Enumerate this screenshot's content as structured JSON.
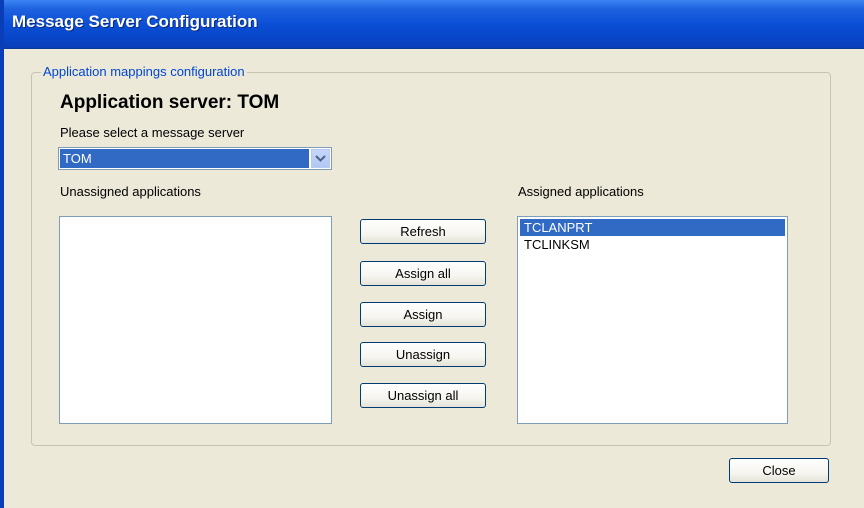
{
  "window": {
    "title": "Message Server Configuration"
  },
  "group": {
    "legend": "Application mappings configuration",
    "heading": "Application server: TOM",
    "select_label": "Please select a message server",
    "server_select": {
      "value": "TOM"
    }
  },
  "unassigned": {
    "label": "Unassigned applications",
    "items": []
  },
  "assigned": {
    "label": "Assigned applications",
    "items": [
      "TCLANPRT",
      "TCLINKSM"
    ],
    "selected_index": 0
  },
  "buttons": {
    "refresh": "Refresh",
    "assign_all": "Assign all",
    "assign": "Assign",
    "unassign": "Unassign",
    "unassign_all": "Unassign all",
    "close": "Close"
  },
  "colors": {
    "title_blue": "#0a4fd6",
    "selection": "#316ac5",
    "legend_blue": "#0046d5"
  },
  "icons": {
    "dropdown": "chevron-down-icon"
  }
}
